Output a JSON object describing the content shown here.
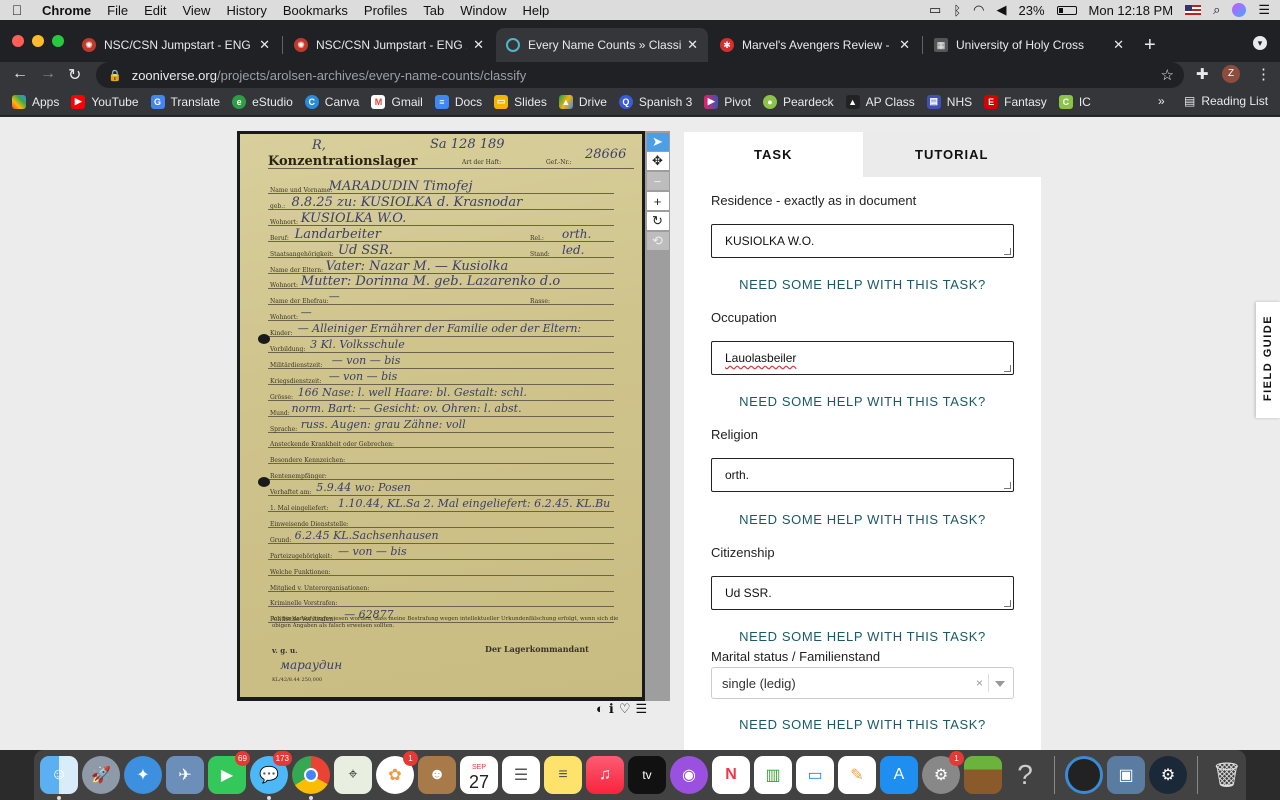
{
  "menubar": {
    "app": "Chrome",
    "items": [
      "File",
      "Edit",
      "View",
      "History",
      "Bookmarks",
      "Profiles",
      "Tab",
      "Window",
      "Help"
    ],
    "battery": "23%",
    "clock": "Mon 12:18 PM"
  },
  "tabs": [
    {
      "title": "NSC/CSN Jumpstart - ENG 101",
      "close": "✕"
    },
    {
      "title": "NSC/CSN Jumpstart - ENG 101",
      "close": "✕"
    },
    {
      "title": "Every Name Counts » Classify",
      "close": "✕"
    },
    {
      "title": "Marvel's Avengers Review - IGN",
      "close": "✕"
    },
    {
      "title": "University of Holy Cross",
      "close": "✕"
    }
  ],
  "toolbar": {
    "url_domain": "zooniverse.org",
    "url_path": "/projects/arolsen-archives/every-name-counts/classify",
    "profile_letter": "Z"
  },
  "bookmarks": {
    "items": [
      "Apps",
      "YouTube",
      "Translate",
      "eStudio",
      "Canva",
      "Gmail",
      "Docs",
      "Slides",
      "Drive",
      "Spanish 3",
      "Pivot",
      "Peardeck",
      "AP Class",
      "NHS",
      "Fantasy",
      "IC"
    ],
    "more": "»",
    "reading_list": "Reading List"
  },
  "document": {
    "title": "Konzentrationslager",
    "top_left": "R,",
    "top_number": "Sa 128 189",
    "haft": "Art der Haft:",
    "gef_nr": "Gef.-Nr.:",
    "gef_value": "28666",
    "rows": [
      {
        "label": "Name und Vorname:",
        "value": "MARADUDIN  Timofej"
      },
      {
        "label": "geb.:",
        "value": "8.8.25   zu: KUSIOLKA d. Krasnodar"
      },
      {
        "label": "Wohnort:",
        "value": "KUSIOLKA  W.O."
      },
      {
        "label": "Beruf:",
        "value": "Landarbeiter",
        "right_label": "Rel.:",
        "right_value": "orth."
      },
      {
        "label": "Staatsangehörigkeit:",
        "value": "Ud SSR.",
        "right_label": "Stand:",
        "right_value": "led."
      },
      {
        "label": "Name der Eltern:",
        "value": "Vater: Nazar M. — Kusiolka"
      },
      {
        "label": "Wohnort:",
        "value": "Mutter: Dorinna M. geb. Lazarenko  d.o"
      },
      {
        "label": "Name der Ehefrau:",
        "value": "—",
        "right_label": "Rasse:",
        "right_value": ""
      },
      {
        "label": "Wohnort:",
        "value": "—"
      },
      {
        "label": "Kinder:",
        "value": "—   Alleiniger Ernährer der Familie oder der Eltern:"
      },
      {
        "label": "Vorbildung:",
        "value": "3 Kl. Volksschule"
      },
      {
        "label": "Militärdienstzeit:",
        "value": "— von — bis"
      },
      {
        "label": "Kriegsdienstzeit:",
        "value": "— von — bis"
      },
      {
        "label": "Grösse:",
        "value": "166   Nase: l. well  Haare: bl.  Gestalt: schl."
      },
      {
        "label": "Mund:",
        "value": "norm.  Bart: —  Gesicht: ov.  Ohren: l. abst."
      },
      {
        "label": "Sprache:",
        "value": "russ.   Augen: grau  Zähne: voll"
      },
      {
        "label": "Ansteckende Krankheit oder Gebrechen:",
        "value": ""
      },
      {
        "label": "Besondere Kennzeichen:",
        "value": ""
      },
      {
        "label": "Rentenempfänger:",
        "value": ""
      },
      {
        "label": "Verhaftet am:",
        "value": "5.9.44   wo: Posen"
      },
      {
        "label": "1. Mal eingeliefert:",
        "value": "1.10.44, KL.Sa  2. Mal eingeliefert: 6.2.45. KL.Bu"
      },
      {
        "label": "Einweisende Dienststelle:",
        "value": ""
      },
      {
        "label": "Grund:",
        "value": "6.2.45 KL.Sachsenhausen"
      },
      {
        "label": "Parteizugehörigkeit:",
        "value": "— von — bis"
      },
      {
        "label": "Welche Funktionen:",
        "value": ""
      },
      {
        "label": "Mitglied v. Unterorganisationen:",
        "value": ""
      },
      {
        "label": "Kriminelle Vorstrafen:",
        "value": ""
      },
      {
        "label": "Politische Vorstrafen:",
        "value": "—   62877"
      }
    ],
    "footer": "Ich bin darauf hingewiesen worden, dass meine Bestrafung wegen intellektueller Urkundenfälschung erfolgt, wenn sich die obigen Angaben als falsch erweisen sollten.",
    "vgu": "v. g. u.",
    "kommandant": "Der Lagerkommandant",
    "print_code": "KL/42/8.44 250,000"
  },
  "panel": {
    "tab_task": "TASK",
    "tab_tutorial": "TUTORIAL",
    "help_text": "NEED SOME HELP WITH THIS TASK?",
    "fields": [
      {
        "label": "Residence - exactly as in document",
        "value": "KUSIOLKA W.O."
      },
      {
        "label": "Occupation",
        "value": "Lauolasbeiler"
      },
      {
        "label": "Religion",
        "value": "orth."
      },
      {
        "label": "Citizenship",
        "value": "Ud SSR."
      }
    ],
    "marital_label": "Marital status / Familienstand",
    "marital_value": "single (ledig)",
    "clear": "×"
  },
  "field_guide": "FIELD GUIDE",
  "dock": {
    "badges": {
      "facetime": "69",
      "messages": "173",
      "photos": "1",
      "prefs": "1"
    },
    "calendar_month": "SEP",
    "calendar_day": "27",
    "tv_label": "tv"
  },
  "colors": {
    "accent_help": "#1a5a68",
    "viewer_select": "#4a9fe8"
  }
}
